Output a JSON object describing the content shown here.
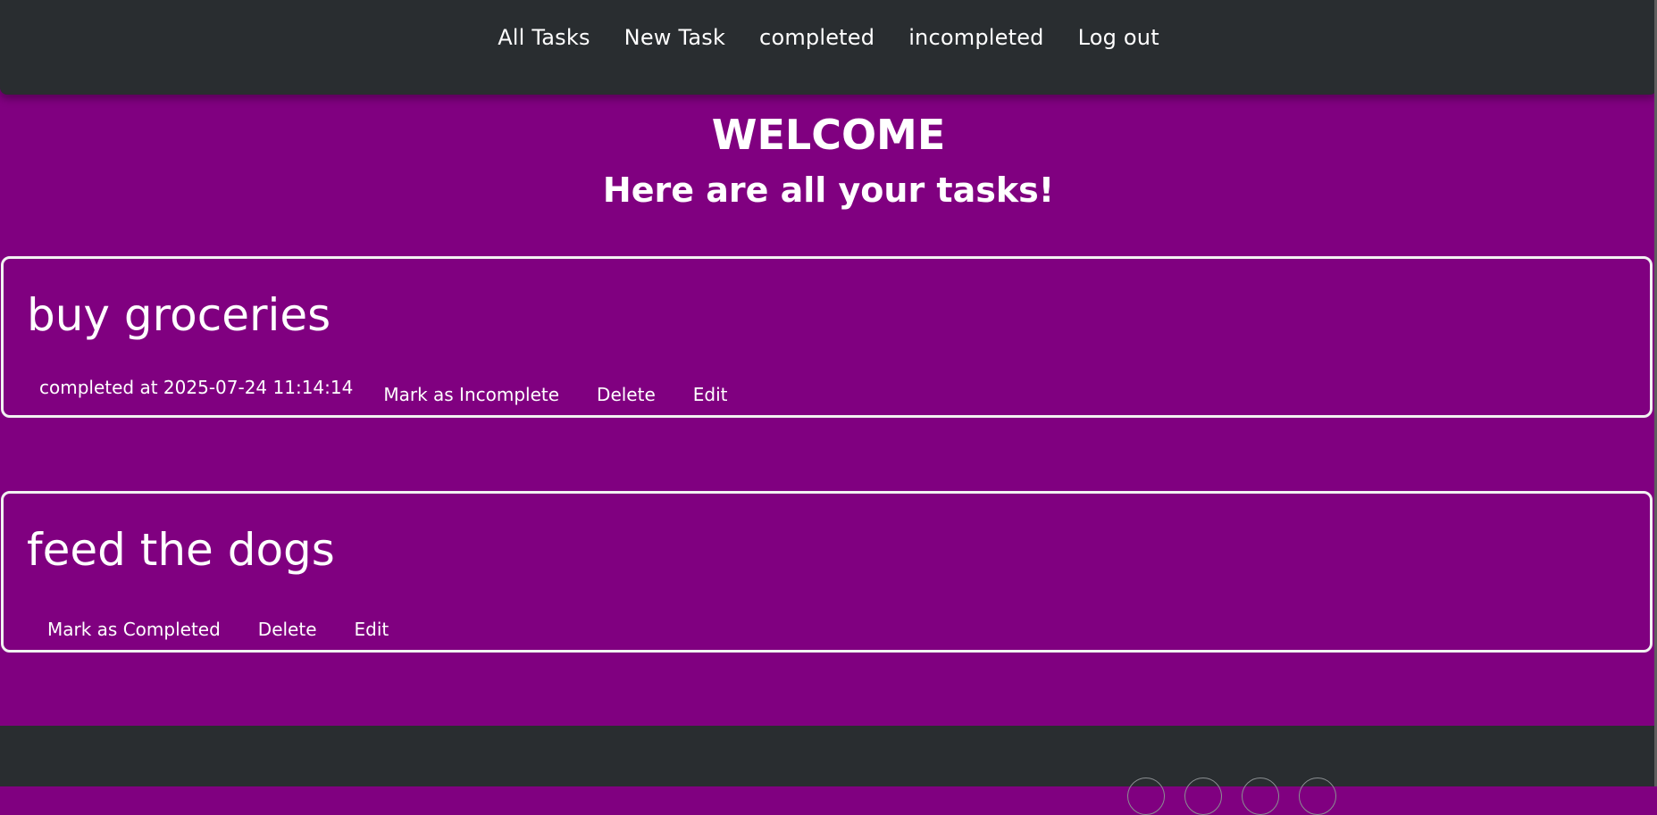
{
  "nav": {
    "items": [
      "All Tasks",
      "New Task",
      "completed",
      "incompleted",
      "Log out"
    ]
  },
  "hero": {
    "title": "WELCOME",
    "subtitle": "Here are all your tasks!"
  },
  "tasks": [
    {
      "title": "buy groceries",
      "status": "completed at 2025-07-24 11:14:14",
      "toggle_label": "Mark as Incomplete",
      "delete_label": "Delete",
      "edit_label": "Edit"
    },
    {
      "title": "feed the dogs",
      "toggle_label": "Mark as Completed",
      "delete_label": "Delete",
      "edit_label": "Edit"
    }
  ],
  "colors": {
    "background": "#800080",
    "navbar": "#292d30",
    "text": "#ffffff",
    "border": "#f2f2f2"
  }
}
